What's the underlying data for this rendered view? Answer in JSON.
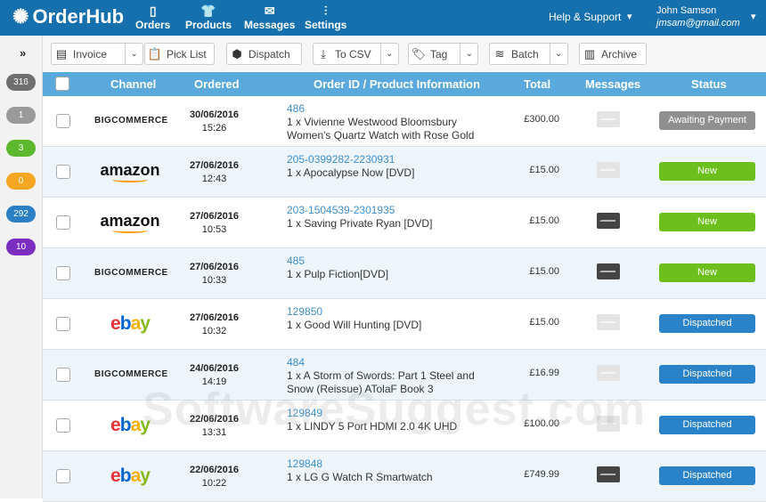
{
  "header": {
    "logo": "OrderHub",
    "nav": [
      {
        "label": "Orders",
        "icon": "document-icon"
      },
      {
        "label": "Products",
        "icon": "tshirt-icon"
      },
      {
        "label": "Messages",
        "icon": "envelope-icon"
      },
      {
        "label": "Settings",
        "icon": "sliders-icon"
      }
    ],
    "help": "Help & Support",
    "user_name": "John Samson",
    "user_email": "jmsam@gmail.com"
  },
  "sidebar": {
    "expand": "»",
    "badges": [
      {
        "count": "316",
        "color": "#6f6f6f"
      },
      {
        "count": "1",
        "color": "#9a9a9a"
      },
      {
        "count": "3",
        "color": "#5cb82e"
      },
      {
        "count": "0",
        "color": "#f5a623"
      },
      {
        "count": "292",
        "color": "#2b7fc4"
      },
      {
        "count": "10",
        "color": "#7b2dbf"
      }
    ]
  },
  "toolbar": {
    "invoice": "Invoice",
    "pick_list": "Pick List",
    "dispatch": "Dispatch",
    "to_csv": "To CSV",
    "tag": "Tag",
    "batch": "Batch",
    "archive": "Archive"
  },
  "table": {
    "headers": {
      "channel": "Channel",
      "ordered": "Ordered",
      "info": "Order ID / Product Information",
      "total": "Total",
      "messages": "Messages",
      "status": "Status"
    },
    "rows": [
      {
        "channel": "BIGCOMMERCE",
        "date": "30/06/2016",
        "time": "15:26",
        "id": "486",
        "line1": "1 x Vivienne Westwood Bloomsbury",
        "line2": "Women's Quartz Watch with Rose Gold",
        "total": "£300.00",
        "msg": false,
        "status": "Awaiting Payment",
        "status_color": "#8f8f8f"
      },
      {
        "channel": "amazon",
        "date": "27/06/2016",
        "time": "12:43",
        "id": "205-0399282-2230931",
        "line1": "1 x Apocalypse Now [DVD]",
        "line2": "",
        "total": "£15.00",
        "msg": false,
        "status": "New",
        "status_color": "#6cbf1c"
      },
      {
        "channel": "amazon",
        "date": "27/06/2016",
        "time": "10:53",
        "id": "203-1504539-2301935",
        "line1": "1 x Saving Private Ryan [DVD]",
        "line2": "",
        "total": "£15.00",
        "msg": true,
        "status": "New",
        "status_color": "#6cbf1c"
      },
      {
        "channel": "BIGCOMMERCE",
        "date": "27/06/2016",
        "time": "10:33",
        "id": "485",
        "line1": "1 x Pulp Fiction[DVD]",
        "line2": "",
        "total": "£15.00",
        "msg": true,
        "status": "New",
        "status_color": "#6cbf1c"
      },
      {
        "channel": "ebay",
        "date": "27/06/2016",
        "time": "10:32",
        "id": "129850",
        "line1": "1 x Good Will Hunting [DVD]",
        "line2": "",
        "total": "£15.00",
        "msg": false,
        "status": "Dispatched",
        "status_color": "#2a83c9"
      },
      {
        "channel": "BIGCOMMERCE",
        "date": "24/06/2016",
        "time": "14:19",
        "id": "484",
        "line1": "1 x A Storm of Swords: Part 1 Steel and",
        "line2": "Snow (Reissue) ATolaF Book 3",
        "total": "£16.99",
        "msg": false,
        "status": "Dispatched",
        "status_color": "#2a83c9"
      },
      {
        "channel": "ebay",
        "date": "22/06/2016",
        "time": "13:31",
        "id": "129849",
        "line1": "1 x LINDY 5 Port HDMI 2.0 4K UHD",
        "line2": "",
        "total": "£100.00",
        "msg": false,
        "status": "Dispatched",
        "status_color": "#2a83c9"
      },
      {
        "channel": "ebay",
        "date": "22/06/2016",
        "time": "10:22",
        "id": "129848",
        "line1": "1 x LG G Watch R Smartwatch",
        "line2": "",
        "total": "£749.99",
        "msg": true,
        "status": "Dispatched",
        "status_color": "#2a83c9"
      }
    ]
  },
  "watermark": "SoftwareSuggest.com"
}
